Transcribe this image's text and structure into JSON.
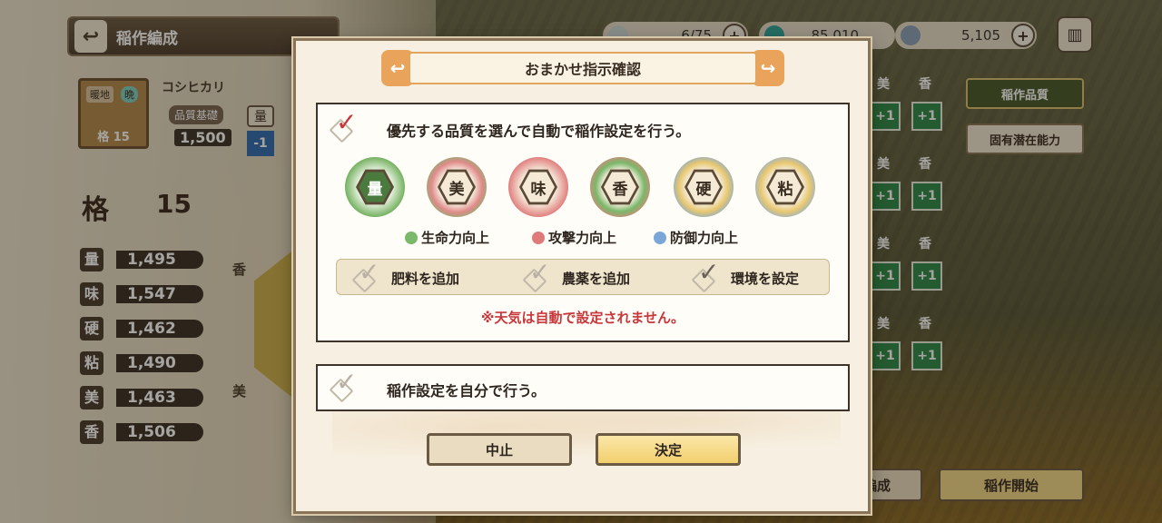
{
  "header": {
    "back_icon": "back-arrow-icon",
    "title": "稲作編成",
    "resources": [
      {
        "icon": "feather-icon",
        "value": "6/75",
        "color": "#cfd8d8"
      },
      {
        "icon": "orb-icon",
        "value": "85,010",
        "color": "#2fa39a"
      },
      {
        "icon": "crystal-icon",
        "value": "5,105",
        "color": "#8aa0b8"
      }
    ],
    "book_icon": "book-icon"
  },
  "left": {
    "rice_badge_1": "暖地",
    "rice_badge_2": "晩",
    "rice_grade": "格 15",
    "rice_name": "コシヒカリ",
    "quality_base_label": "品質基礎",
    "quality_base_value": "1,500",
    "mini_stat": "量",
    "mini_change": "-1",
    "grade_label": "格",
    "grade_value": "15",
    "stats": [
      {
        "label": "量",
        "value": "1,495"
      },
      {
        "label": "味",
        "value": "1,547"
      },
      {
        "label": "硬",
        "value": "1,462"
      },
      {
        "label": "粘",
        "value": "1,490"
      },
      {
        "label": "美",
        "value": "1,463"
      },
      {
        "label": "香",
        "value": "1,506"
      }
    ],
    "radar_labels": {
      "top": "香",
      "bottom": "美"
    }
  },
  "right": {
    "buttons": [
      "稲作品質",
      "固有潜在能力"
    ],
    "grid_headers": [
      "美",
      "香"
    ],
    "plus_value": "+1",
    "bottom_buttons": [
      "おまかせ編成",
      "稲作開始"
    ]
  },
  "dialog": {
    "title": "おまかせ指示確認",
    "option1_text": "優先する品質を選んで自動で稲作設定を行う。",
    "qualities": [
      {
        "label": "量",
        "color": "#6fae5a",
        "selected": true
      },
      {
        "label": "美",
        "color": "#7ab86a",
        "selected": false
      },
      {
        "label": "味",
        "color": "#e07a7a",
        "selected": false
      },
      {
        "label": "香",
        "color": "#e87e7e",
        "selected": false
      },
      {
        "label": "硬",
        "color": "#7aa6d8",
        "selected": false
      },
      {
        "label": "粘",
        "color": "#86acdc",
        "selected": false
      }
    ],
    "legend": [
      {
        "text": "生命力向上",
        "color": "#7ab86a"
      },
      {
        "text": "攻撃力向上",
        "color": "#e07a7a"
      },
      {
        "text": "防御力向上",
        "color": "#7aa6d8"
      }
    ],
    "sub_options": [
      {
        "text": "肥料を追加",
        "checked": false
      },
      {
        "text": "農薬を追加",
        "checked": false
      },
      {
        "text": "環境を設定",
        "checked": true
      }
    ],
    "notice": "※天気は自動で設定されません。",
    "option2_text": "稲作設定を自分で行う。",
    "cancel_label": "中止",
    "ok_label": "決定"
  }
}
